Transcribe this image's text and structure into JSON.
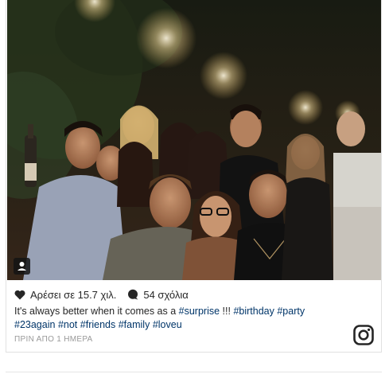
{
  "post": {
    "likes_text": "Αρέσει σε 15.7 χιλ.",
    "comments_text": "54 σχόλια",
    "caption_line1_plain": "It's always better when it comes as a ",
    "caption_line1_tags": [
      "#surprise",
      "#birthday",
      "#party"
    ],
    "caption_line1_exclaim": " !!! ",
    "caption_line2_tags": [
      "#23again",
      "#not",
      "#friends",
      "#family",
      "#loveu"
    ],
    "timestamp": "ΠΡΙΝ ΑΠΟ 1 ΗΜΕΡΑ"
  },
  "icons": {
    "like": "heart-icon",
    "comment": "speech-bubble-icon",
    "brand": "instagram-icon",
    "user_tag": "user-tag-icon"
  },
  "colors": {
    "text": "#262626",
    "hashtag": "#003569",
    "muted": "#999999",
    "border": "#e1e1e1"
  }
}
